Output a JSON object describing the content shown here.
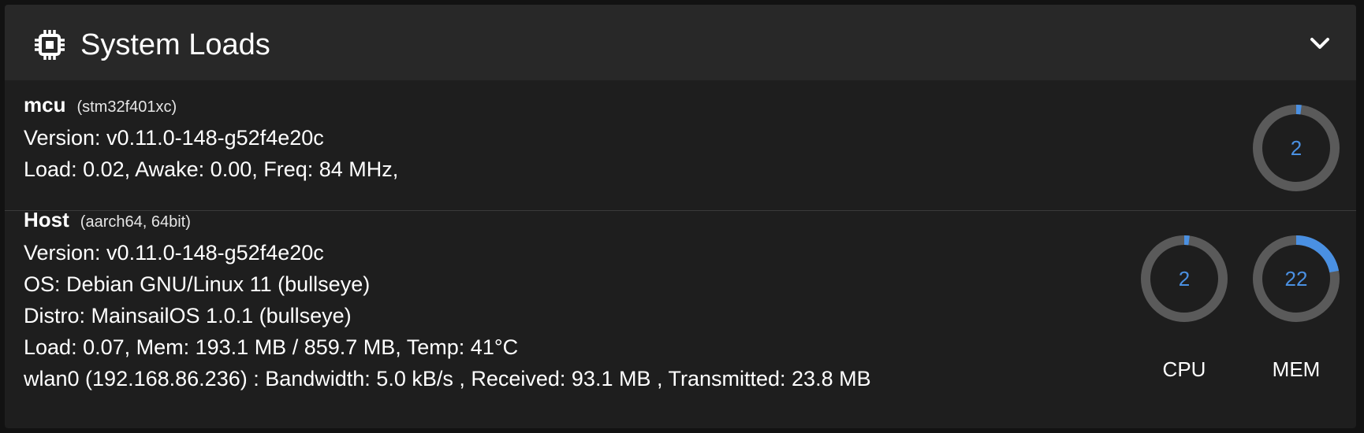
{
  "header": {
    "title": "System Loads",
    "icon": "cpu-chip-icon",
    "collapse_icon": "chevron-up-icon"
  },
  "mcu": {
    "name": "mcu",
    "chip": "(stm32f401xc)",
    "version": "Version: v0.11.0-148-g52f4e20c",
    "stats": "Load: 0.02, Awake: 0.00, Freq: 84 MHz,",
    "gauge": {
      "value": 2,
      "label": "2",
      "percent": 2
    }
  },
  "host": {
    "name": "Host",
    "arch": "(aarch64, 64bit)",
    "version": "Version: v0.11.0-148-g52f4e20c",
    "os": "OS: Debian GNU/Linux 11 (bullseye)",
    "distro": "Distro: MainsailOS 1.0.1 (bullseye)",
    "stats": "Load: 0.07, Mem: 193.1 MB / 859.7 MB, Temp: 41°C",
    "network": "wlan0 (192.168.86.236) : Bandwidth: 5.0 kB/s , Received: 93.1 MB , Transmitted: 23.8 MB",
    "cpu_gauge": {
      "value": 2,
      "label": "2",
      "percent": 2,
      "caption": "CPU"
    },
    "mem_gauge": {
      "value": 22,
      "label": "22",
      "percent": 22,
      "caption": "MEM"
    }
  },
  "colors": {
    "accent": "#4a90e2",
    "track": "#5a5a5a",
    "panel": "#1e1e1e",
    "header": "#282828"
  }
}
